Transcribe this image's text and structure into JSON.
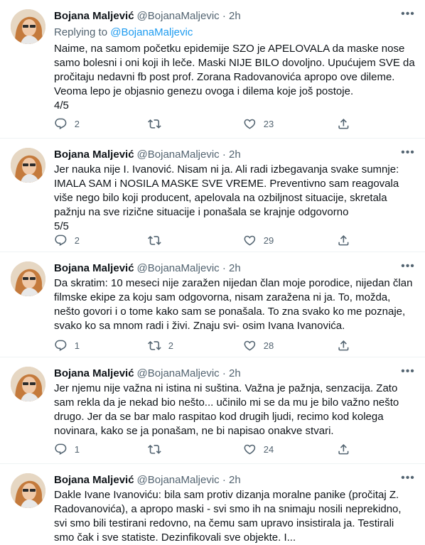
{
  "tweets": [
    {
      "name": "Bojana Maljević",
      "handle": "@BojanaMaljevic",
      "dot": "·",
      "time": "2h",
      "more": "•••",
      "replying_prefix": "Replying to ",
      "replying_to": "@BojanaMaljevic",
      "text": "Naime, na samom početku epidemije SZO je APELOVALA da maske nose samo bolesni i oni koji ih leče. Maski NIJE BILO dovoljno. Upućujem SVE da pročitaju nedavni fb post prof. Zorana Radovanovića apropo ove dileme. Veoma lepo je objasnio genezu ovoga i dilema koje još postoje.\n4/5",
      "replies": "2",
      "retweets": "",
      "likes": "23"
    },
    {
      "name": "Bojana Maljević",
      "handle": "@BojanaMaljevic",
      "dot": "·",
      "time": "2h",
      "more": "•••",
      "text": "Jer nauka nije I. Ivanović. Nisam ni ja. Ali radi izbegavanja svake sumnje: IMALA SAM i NOSILA MASKE SVE VREME. Preventivno sam reagovala više nego bilo koji producent, apelovala na ozbiljnost situacije, skretala pažnju na sve rizične situacije i ponašala se krajnje odgovorno\n5/5",
      "replies": "2",
      "retweets": "",
      "likes": "29"
    },
    {
      "name": "Bojana Maljević",
      "handle": "@BojanaMaljevic",
      "dot": "·",
      "time": "2h",
      "more": "•••",
      "text": "Da skratim: 10 meseci nije zaražen nijedan član moje porodice, nijedan član filmske ekipe za koju sam odgovorna, nisam zaražena ni ja. To, možda, nešto govori i o tome kako sam se ponašala. To zna svako ko me poznaje, svako ko sa mnom radi i živi. Znaju svi- osim Ivana Ivanovića.",
      "replies": "1",
      "retweets": "2",
      "likes": "28"
    },
    {
      "name": "Bojana Maljević",
      "handle": "@BojanaMaljevic",
      "dot": "·",
      "time": "2h",
      "more": "•••",
      "text": "Jer njemu nije važna ni istina ni suština. Važna je pažnja, senzacija. Zato sam rekla da je nekad bio nešto... učinilo mi se da mu je bilo važno nešto drugo. Jer da se bar malo raspitao kod drugih ljudi, recimo kod kolega novinara, kako se ja ponašam, ne bi napisao onakve stvari.",
      "replies": "1",
      "retweets": "",
      "likes": "24"
    },
    {
      "name": "Bojana Maljević",
      "handle": "@BojanaMaljevic",
      "dot": "·",
      "time": "2h",
      "more": "•••",
      "text": "Dakle Ivane Ivanoviću: bila sam protiv dizanja moralne panike (pročitaj Z. Radovanovića), a apropo maski - svi smo ih na snimaju nosili neprekidno, svi smo bili testirani redovno, na čemu sam upravo insistirala ja. Testirali smo čak i sve statiste. Dezinfikovali sve objekte. I..."
    }
  ]
}
